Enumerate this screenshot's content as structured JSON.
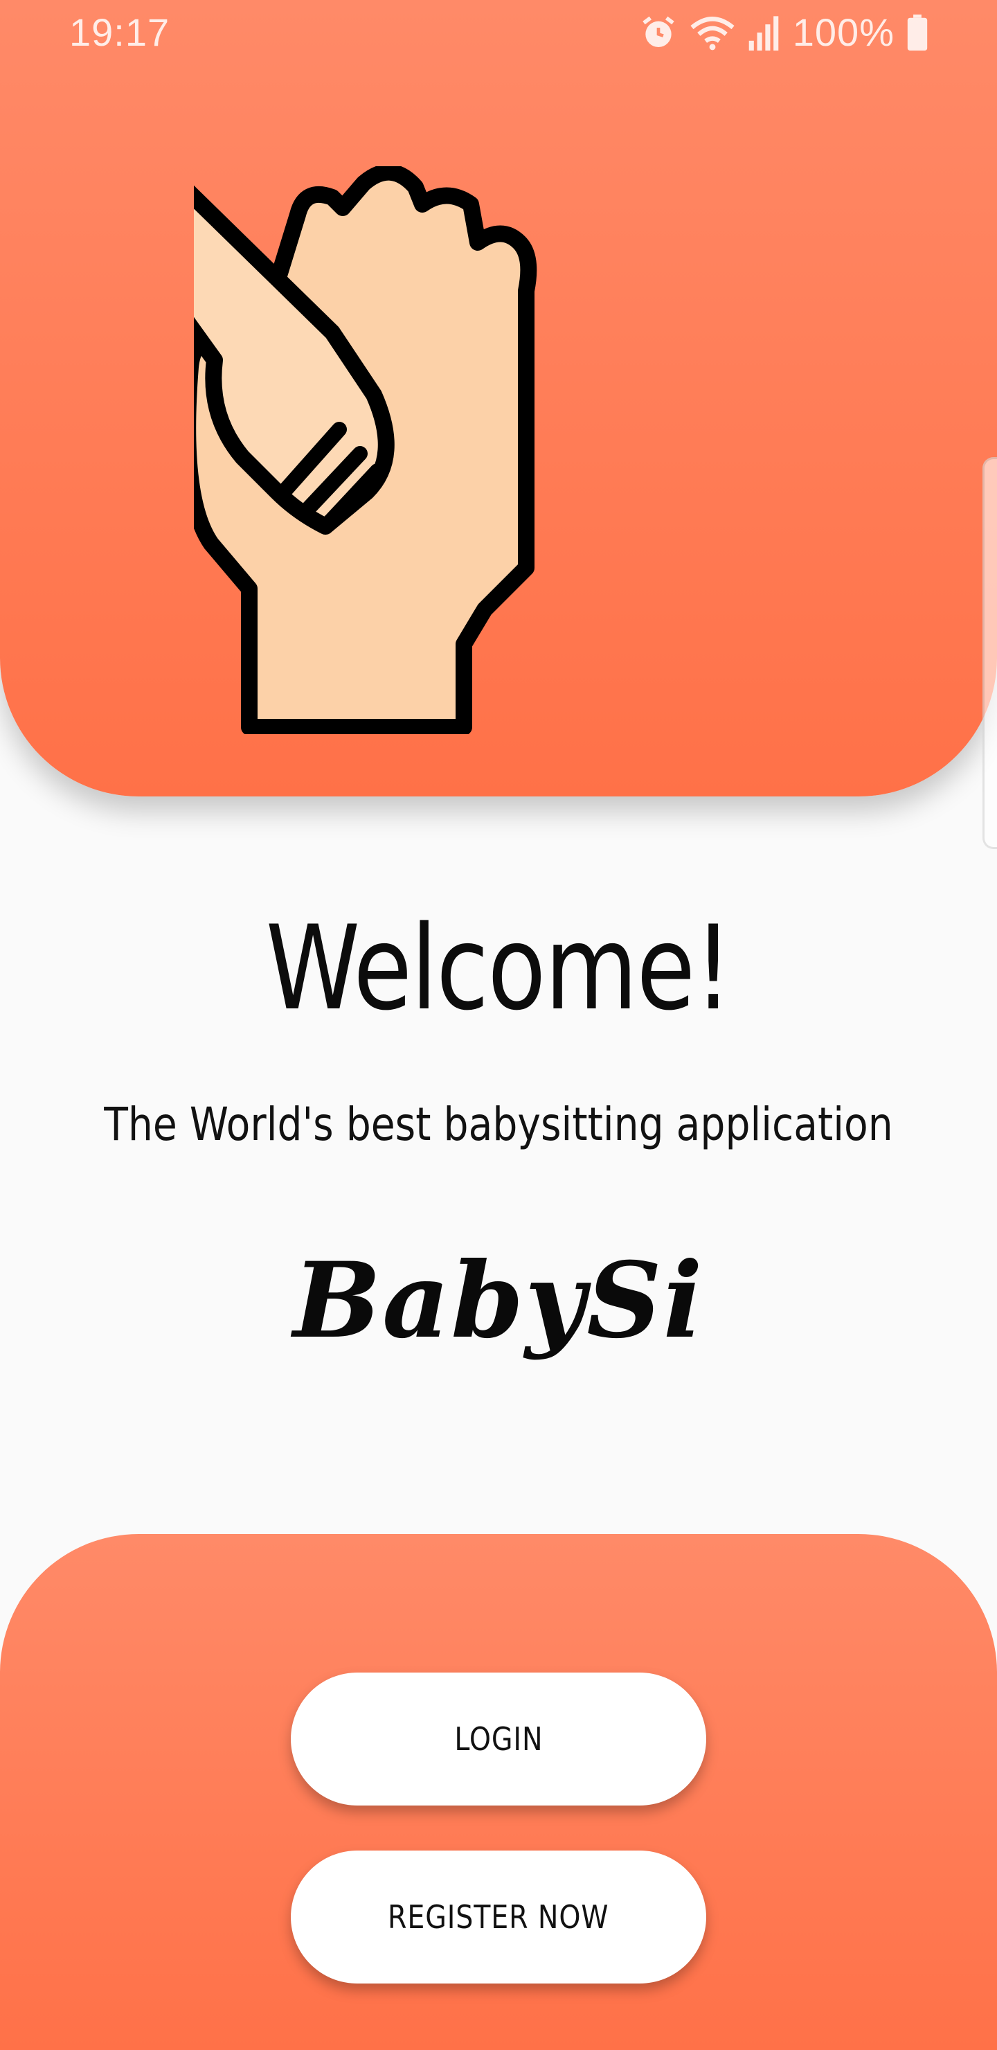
{
  "status_bar": {
    "time": "19:17",
    "battery": "100%"
  },
  "hero": {
    "illustration_icon": "hand-holding-child-hand-icon"
  },
  "welcome": {
    "title": "Welcome!",
    "tagline": "The World's best babysitting application",
    "brand": "BabySi"
  },
  "actions": {
    "login_label": "LOGIN",
    "register_label": "REGISTER NOW"
  },
  "colors": {
    "accent_top": "#ff8a68",
    "accent_bottom": "#ff7148",
    "skin": "#fcd1a8",
    "background": "#fafafa"
  }
}
